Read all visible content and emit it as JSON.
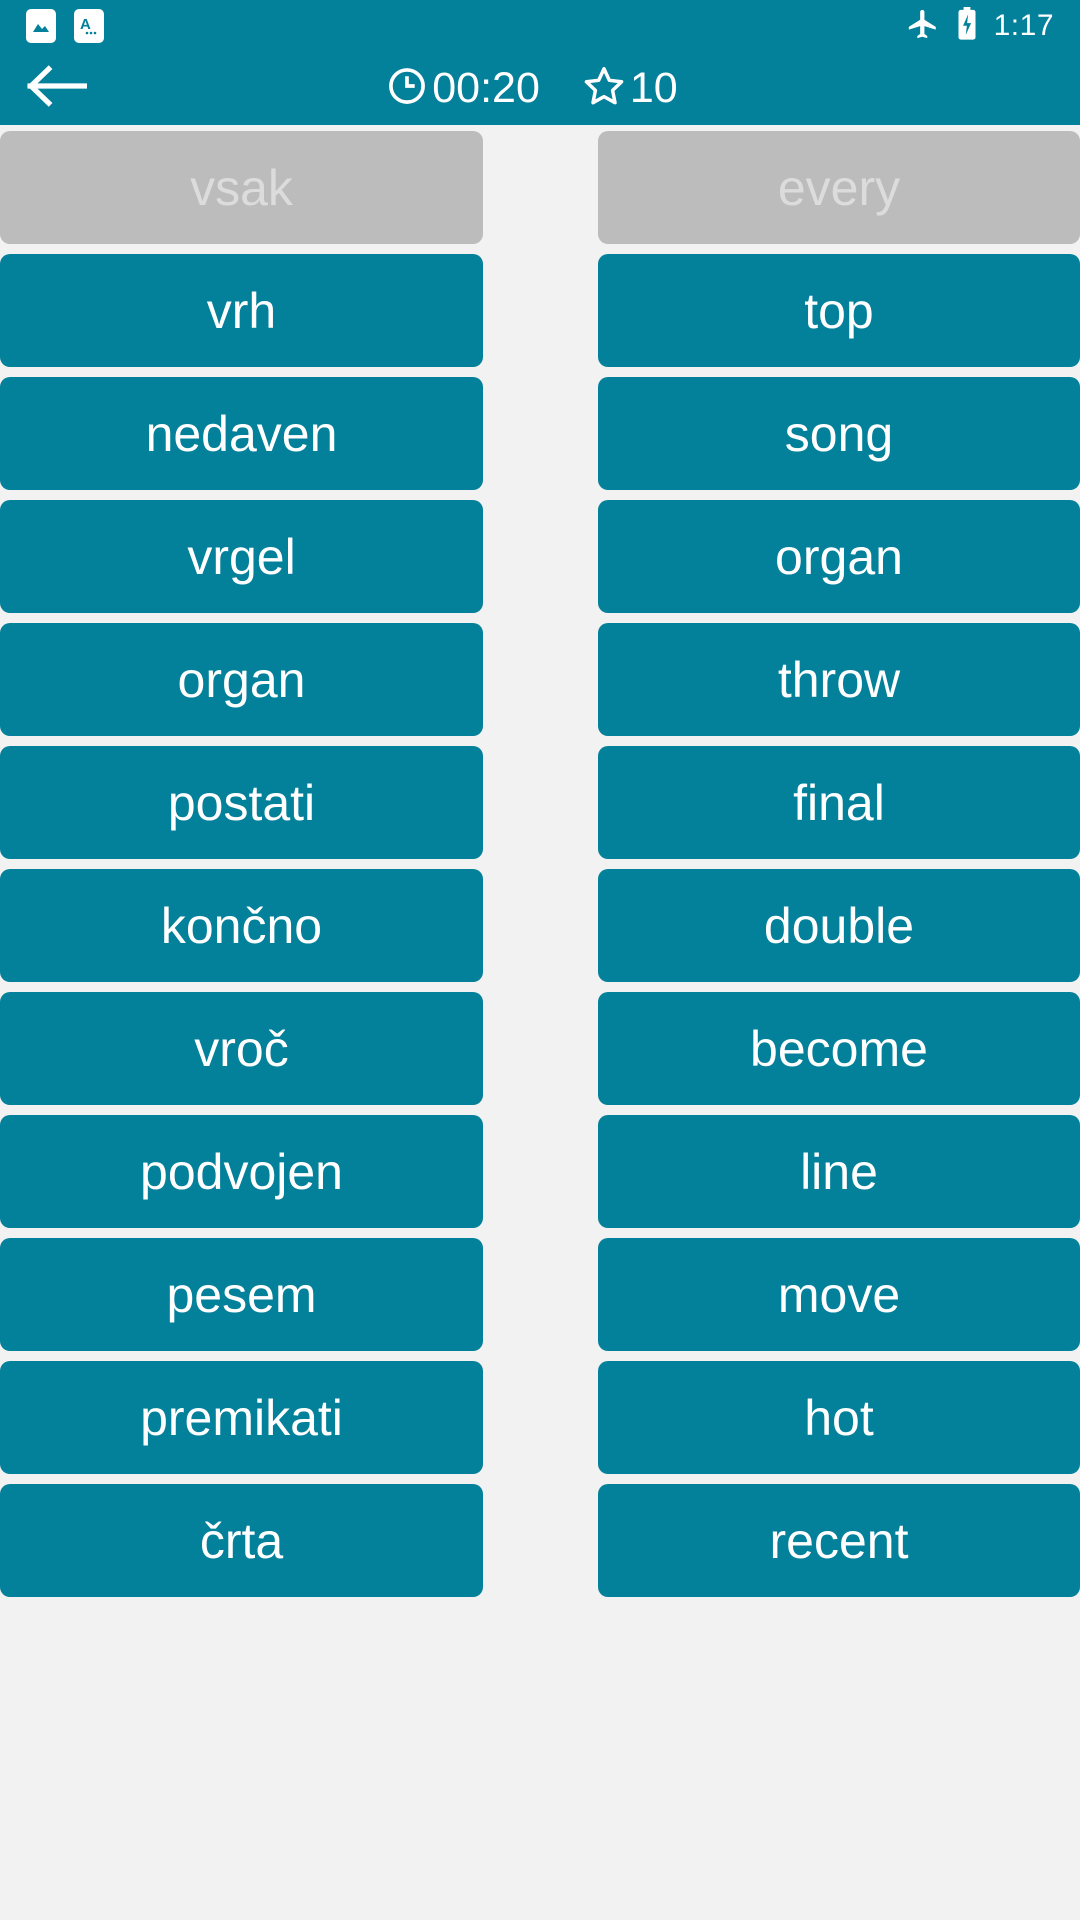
{
  "status_bar": {
    "icons_left": [
      "image-icon",
      "translate-icon"
    ],
    "icons_right": [
      "airplane-mode-icon",
      "battery-charging-icon"
    ],
    "time": "1:17"
  },
  "app_bar": {
    "back_icon": "arrow-left-icon",
    "timer_icon": "clock-icon",
    "timer": "00:20",
    "score_icon": "star-icon",
    "score": "10"
  },
  "colors": {
    "primary": "#03809a",
    "matched_bg": "#bcbcbc",
    "matched_text": "#dcdcdc",
    "board_bg": "#f2f2f2",
    "card_text": "#ffffff"
  },
  "board": {
    "left_column": [
      {
        "label": "vsak",
        "state": "matched"
      },
      {
        "label": "vrh",
        "state": "active"
      },
      {
        "label": "nedaven",
        "state": "active"
      },
      {
        "label": "vrgel",
        "state": "active"
      },
      {
        "label": "organ",
        "state": "active"
      },
      {
        "label": "postati",
        "state": "active"
      },
      {
        "label": "končno",
        "state": "active"
      },
      {
        "label": "vroč",
        "state": "active"
      },
      {
        "label": "podvojen",
        "state": "active"
      },
      {
        "label": "pesem",
        "state": "active"
      },
      {
        "label": "premikati",
        "state": "active"
      },
      {
        "label": "črta",
        "state": "active"
      }
    ],
    "right_column": [
      {
        "label": "every",
        "state": "matched"
      },
      {
        "label": "top",
        "state": "active"
      },
      {
        "label": "song",
        "state": "active"
      },
      {
        "label": "organ",
        "state": "active"
      },
      {
        "label": "throw",
        "state": "active"
      },
      {
        "label": "final",
        "state": "active"
      },
      {
        "label": "double",
        "state": "active"
      },
      {
        "label": "become",
        "state": "active"
      },
      {
        "label": "line",
        "state": "active"
      },
      {
        "label": "move",
        "state": "active"
      },
      {
        "label": "hot",
        "state": "active"
      },
      {
        "label": "recent",
        "state": "active"
      }
    ]
  }
}
